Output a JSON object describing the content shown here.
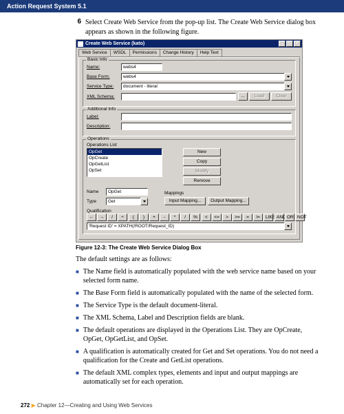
{
  "topbar": {
    "title": "Action Request System 5.1"
  },
  "step": {
    "num": "6",
    "text": "Select Create Web Service from the pop-up list. The Create Web Service dialog box appears as shown in the following figure."
  },
  "dialog": {
    "title": "Create Web Service (kato)",
    "ctrlMin": "_",
    "ctrlMax": "□",
    "ctrlClose": "×",
    "tabs": [
      "Web Service",
      "WSDL",
      "Permissions",
      "Change History",
      "Help Text"
    ],
    "basic": {
      "title": "Basic Info",
      "nameLabel": "Name:",
      "nameValue": "webs4",
      "baseFormLabel": "Base Form:",
      "baseFormValue": "webs4",
      "serviceTypeLabel": "Service Type:",
      "serviceTypeValue": "document - literal",
      "xmlSchemaLabel": "XML Schema:",
      "xmlSchemaValue": "",
      "browseBtn": "...",
      "loadBtn": "Load",
      "clearBtn": "Clear"
    },
    "additional": {
      "title": "Additional Info",
      "labelLabel": "Label:",
      "labelValue": "",
      "descLabel": "Description:",
      "descValue": ""
    },
    "ops": {
      "title": "Operations",
      "listLabel": "Operations List",
      "items": [
        "OpGet",
        "OpCreate",
        "OpGetList",
        "OpSet"
      ],
      "newBtn": "New",
      "copyBtn": "Copy",
      "modifyBtn": "Modify",
      "removeBtn": "Remove",
      "nameLabel": "Name",
      "nameValue": "OpGet",
      "typeLabel": "Type",
      "typeValue": "Get",
      "mappingsTitle": "Mappings",
      "inputMappingBtn": "Input Mapping...",
      "outputMappingBtn": "Output Mapping..."
    },
    "qual": {
      "title": "Qualification",
      "bar": [
        "←",
        "→",
        "/",
        "÷",
        "(",
        ")",
        "+",
        "-",
        "*",
        "/",
        "%",
        "<",
        "<=",
        ">",
        ">=",
        "=",
        "!=",
        "LIKE",
        "AND",
        "OR",
        "NOT"
      ],
      "value": "'Request ID' = XPATH(/ROOT/Request_ID)"
    }
  },
  "caption": "Figure 12-3:  The Create Web Service Dialog Box",
  "intro": "The default settings are as follows:",
  "bullets": [
    "The Name field is automatically populated with the web service name based on your selected form name.",
    "The Base Form field is automatically populated with the name of the selected form.",
    "The Service Type is the default document-literal.",
    "The XML Schema, Label and Description fields are blank.",
    "The default operations are displayed in the Operations List. They are OpCreate, OpGet, OpGetList, and OpSet.",
    "A qualification is automatically created for Get and Set operations. You do not need a qualification for the Create and GetList operations.",
    "The default XML complex types, elements and input and output mappings are automatically set for each operation."
  ],
  "footer": {
    "page": "272",
    "arrow": "▶",
    "chapter": "Chapter 12—Creating and Using Web Services"
  }
}
